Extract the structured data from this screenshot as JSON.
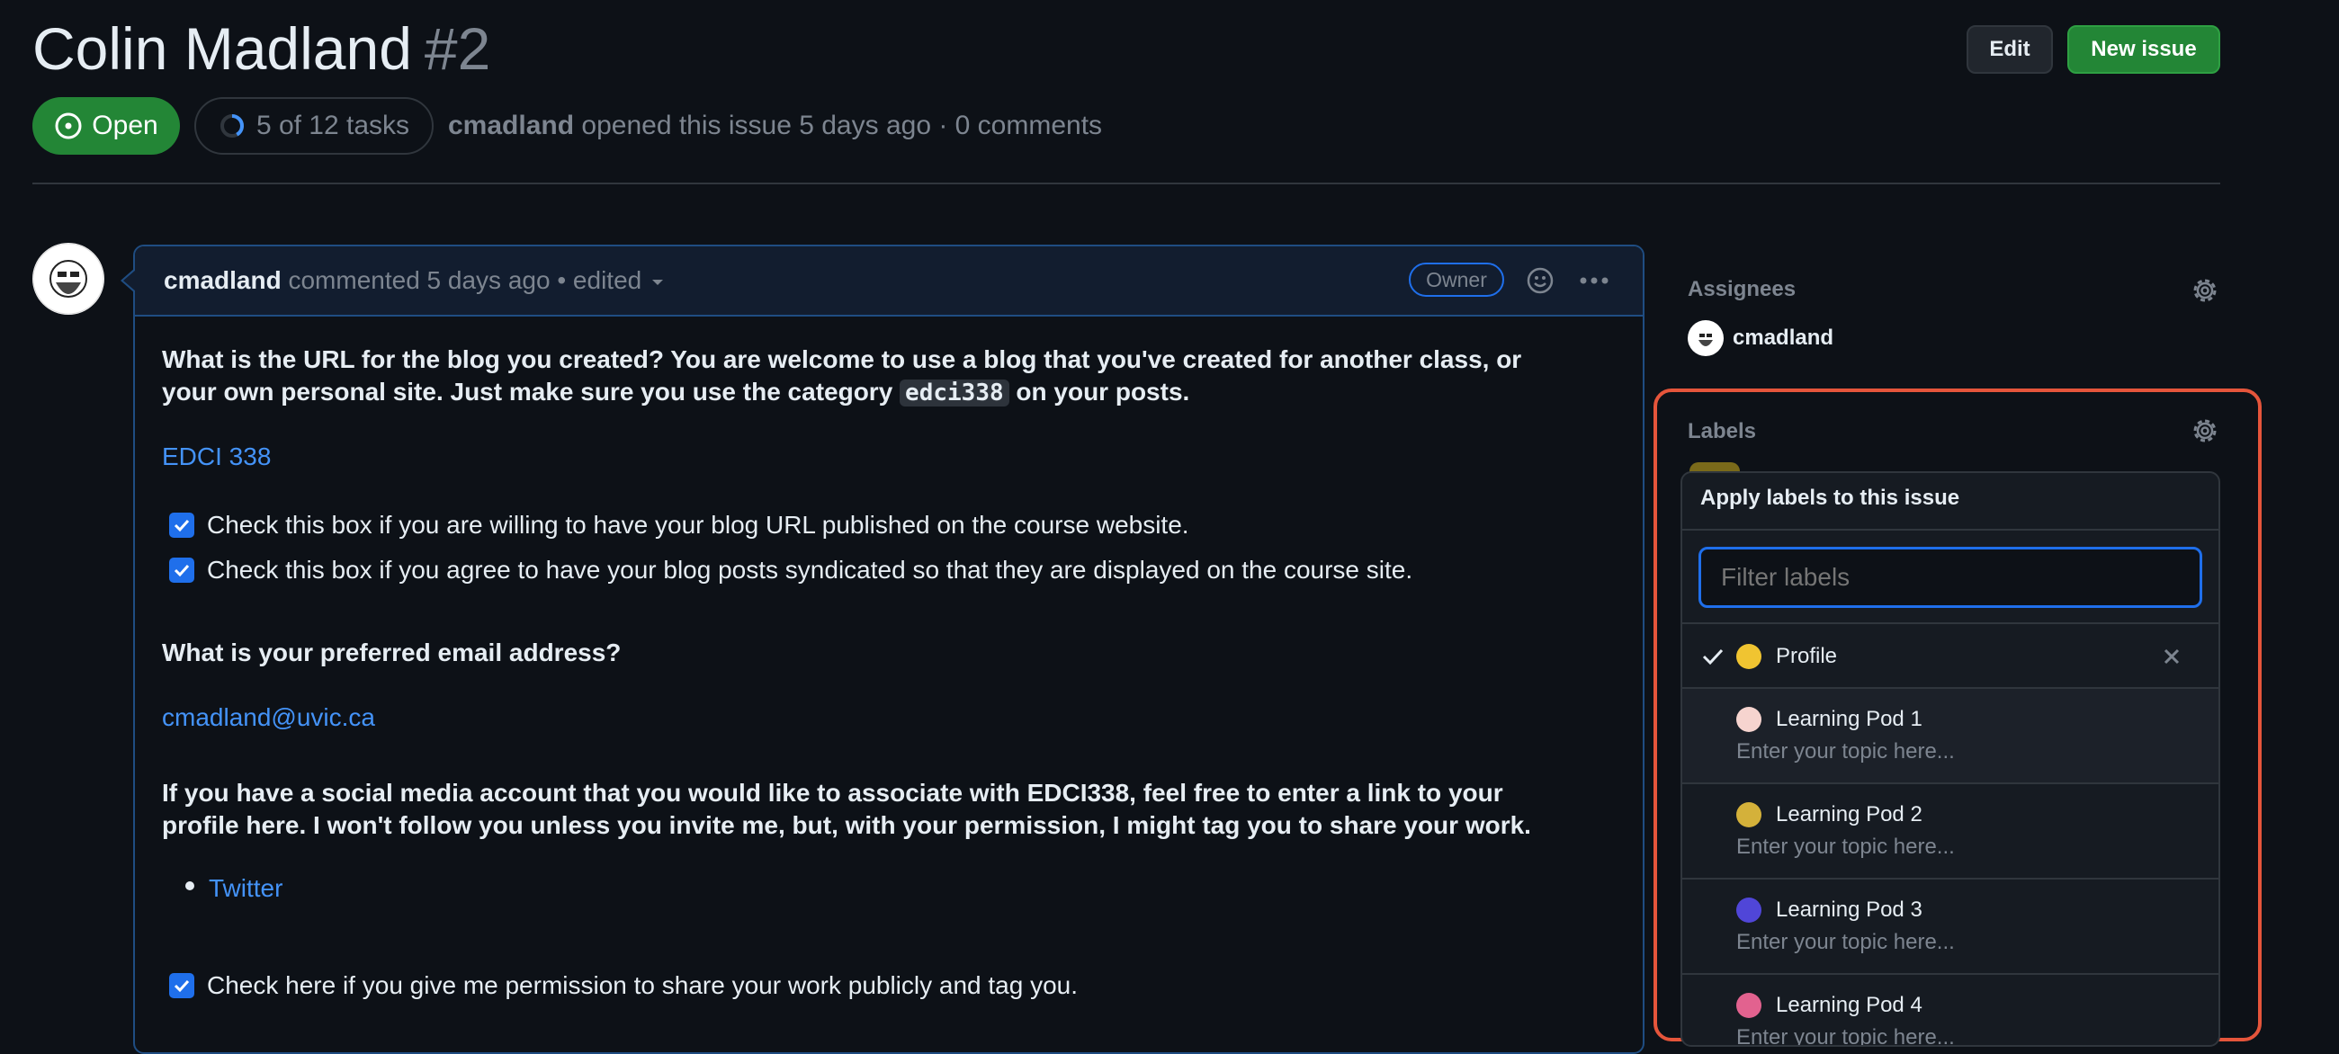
{
  "issue": {
    "title": "Colin Madland",
    "number": "#2",
    "state": "Open",
    "tasks": "5 of 12 tasks",
    "author": "cmadland",
    "opened_text": "opened this issue 5 days ago · 0 comments",
    "tasks_progress": 0.4167
  },
  "header": {
    "edit_label": "Edit",
    "new_issue_label": "New issue"
  },
  "comment": {
    "author": "cmadland",
    "meta": "commented 5 days ago",
    "edited": "edited",
    "role": "Owner",
    "q1_a": "What is the URL for the blog you created? You are welcome to use a blog that you've created for another class, or",
    "q1_b": "your own personal site. Just make sure you use the category",
    "q1_code": "edci338",
    "q1_c": "on your posts.",
    "blog_link": "EDCI 338",
    "check1": "Check this box if you are willing to have your blog URL published on the course website.",
    "check2": "Check this box if you agree to have your blog posts syndicated so that they are displayed on the course site.",
    "q2": "What is your preferred email address?",
    "email": "cmadland@uvic.ca",
    "q3_a": "If you have a social media account that you would like to associate with EDCI338, feel free to enter a link to your",
    "q3_b": "profile here. I won't follow you unless you invite me, but, with your permission, I might tag you to share your work.",
    "social_link": "Twitter",
    "check3": "Check here if you give me permission to share your work publicly and tag you."
  },
  "sidebar": {
    "assignees_heading": "Assignees",
    "assignee": "cmadland",
    "labels_heading": "Labels",
    "popover": {
      "title": "Apply labels to this issue",
      "filter_placeholder": "Filter labels",
      "labels": [
        {
          "name": "Profile",
          "color": "#f0c431",
          "selected": true
        },
        {
          "name": "Learning Pod 1",
          "color": "#f6d4cf",
          "description": "Enter your topic here..."
        },
        {
          "name": "Learning Pod 2",
          "color": "#d4b13a",
          "description": "Enter your topic here..."
        },
        {
          "name": "Learning Pod 3",
          "color": "#5046d8",
          "description": "Enter your topic here..."
        },
        {
          "name": "Learning Pod 4",
          "color": "#e2628f",
          "description": "Enter your topic here..."
        }
      ]
    }
  },
  "colors": {
    "accent": "#1f6feb",
    "open_green": "#238636",
    "highlight": "#e5553b"
  }
}
